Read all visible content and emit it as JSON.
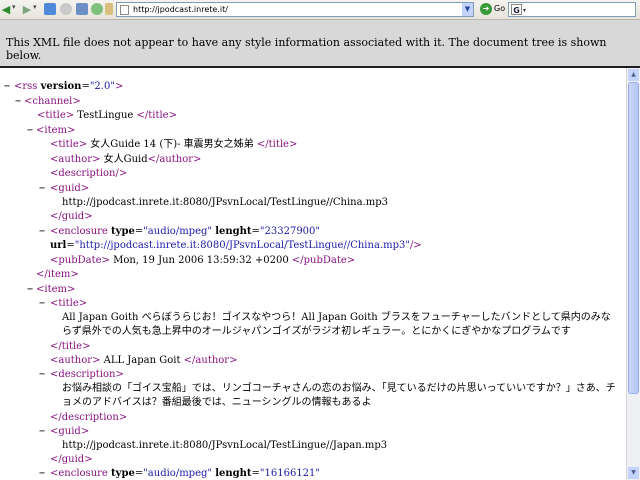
{
  "toolbar": {
    "back_icon": "back-arrow",
    "forward_icon": "forward-arrow",
    "url": "http://jpodcast.inrete.it/",
    "go_label": "Go",
    "search_engine_icon": "google-icon"
  },
  "banner": {
    "message": "This XML file does not appear to have any style information associated with it. The document tree is shown below."
  },
  "tree": {
    "rss_open": "<rss",
    "rss_attr": "version",
    "rss_val": "\"2.0\"",
    "channel_open": "<channel>",
    "channel_title": "TestLingue",
    "item_open": "<item>",
    "item_close": "</item>",
    "item1": {
      "title": "女人Guide 14 (下)- 車震男女之姊弟",
      "author": "女人Guid",
      "guid": "http://jpodcast.inrete.it:8080/JPsvnLocal/TestLingue//China.mp3",
      "enclosure_type": "\"audio/mpeg\"",
      "enclosure_length": "\"23327900\"",
      "enclosure_url": "\"http://jpodcast.inrete.it:8080/JPsvnLocal/TestLingue//China.mp3\"",
      "pubdate": "Mon, 19 Jun 2006 13:59:32 +0200"
    },
    "item2": {
      "title": "All Japan Goith べらぼうらじお！ゴイスなやつら！All Japan Goith ブラスをフューチャーしたバンドとして県内のみならず県外での人気も急上昇中のオールジャパンゴイズがラジオ初レギュラー。とにかくにぎやかなプログラムです",
      "author": "ALL Japan Goit",
      "description": "お悩み相談の「ゴイス宝船」では、リンゴコーチャさんの恋のお悩み、「見ているだけの片思いっていいですか？」さあ、チョメのアドバイスは？番組最後では、ニューシングルの情報もあるよ",
      "guid": "http://jpodcast.inrete.it:8080/JPsvnLocal/TestLingue//Japan.mp3",
      "enclosure_type": "\"audio/mpeg\"",
      "enclosure_length": "\"16166121\""
    },
    "labels": {
      "title_open": "<title>",
      "title_close": "</title>",
      "author_open": "<author>",
      "author_close": "</author>",
      "description_empty": "<description/>",
      "description_open": "<description>",
      "description_close": "</description>",
      "guid_open": "<guid>",
      "guid_close": "</guid>",
      "enclosure_open": "<enclosure",
      "attr_type": "type",
      "attr_lenght": "lenght",
      "attr_url": "url",
      "pubdate_open": "<pubDate>",
      "pubdate_close": "</pubDate>",
      "gt": ">",
      "selfclose": "/>",
      "eq": "=",
      "minus": "−"
    }
  }
}
